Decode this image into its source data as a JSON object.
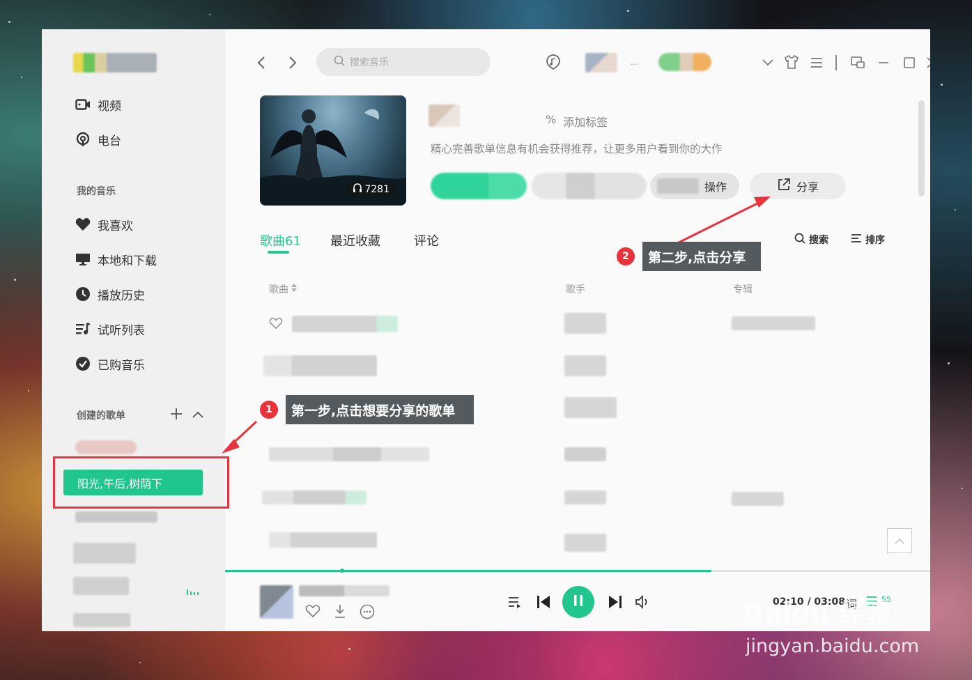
{
  "sidebar": {
    "items_top": [
      {
        "label": "视频",
        "icon": "video-icon"
      },
      {
        "label": "电台",
        "icon": "radio-icon"
      }
    ],
    "my_music_title": "我的音乐",
    "my_music_items": [
      {
        "label": "我喜欢",
        "icon": "heart-icon"
      },
      {
        "label": "本地和下载",
        "icon": "monitor-icon"
      },
      {
        "label": "播放历史",
        "icon": "clock-icon"
      },
      {
        "label": "试听列表",
        "icon": "playlist-icon"
      },
      {
        "label": "已购音乐",
        "icon": "check-circle-icon"
      }
    ],
    "created_title": "创建的歌单",
    "selected_playlist": "阳光,午后,树荫下"
  },
  "topbar": {
    "search_placeholder": "搜索音乐",
    "more_dots": "..."
  },
  "playlist": {
    "play_count": "7281",
    "add_tag": "添加标签",
    "tag_symbol": "%",
    "description": "精心完善歌单信息有机会获得推荐，让更多用户看到你的大作",
    "operate_label": "操作",
    "share_label": "分享"
  },
  "tabs": [
    {
      "label": "歌曲61",
      "active": true
    },
    {
      "label": "最近收藏",
      "active": false
    },
    {
      "label": "评论",
      "active": false
    }
  ],
  "tools": {
    "search": "搜索",
    "sort": "排序"
  },
  "columns": {
    "song": "歌曲",
    "artist": "歌手",
    "album": "专辑"
  },
  "player": {
    "time": "02:10 / 03:08",
    "lyrics_label": "词",
    "queue_count": "55",
    "progress": 0.69
  },
  "annotations": {
    "step1_num": "1",
    "step1": "第一步,点击想要分享的歌单",
    "step2_num": "2",
    "step2": "第二步,点击分享"
  },
  "watermark": {
    "brand": "Baidu 经验",
    "url": "jingyan.baidu.com"
  },
  "colors": {
    "accent": "#21c58e",
    "annotation_red": "#e8323c"
  }
}
